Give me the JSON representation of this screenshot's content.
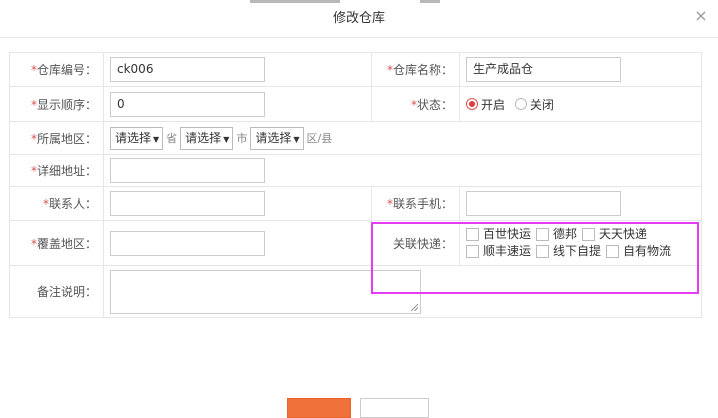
{
  "dialog": {
    "title": "修改仓库",
    "close": "×"
  },
  "form": {
    "code": {
      "label": "仓库编号：",
      "value": "ck006"
    },
    "name": {
      "label": "仓库名称：",
      "value": "生产成品仓"
    },
    "order": {
      "label": "显示顺序：",
      "value": "0"
    },
    "status": {
      "label": "状态：",
      "options": [
        "开启",
        "关闭"
      ],
      "selected": "开启"
    },
    "region": {
      "label": "所属地区：",
      "province_select": "请选择",
      "province_unit": "省",
      "city_select": "请选择",
      "city_unit": "市",
      "district_select": "请选择",
      "district_unit": "区/县"
    },
    "address": {
      "label": "详细地址：",
      "value": ""
    },
    "contact": {
      "label": "联系人：",
      "value": ""
    },
    "phone": {
      "label": "联系手机：",
      "value": ""
    },
    "coverage": {
      "label": "覆盖地区：",
      "value": ""
    },
    "express": {
      "label": "关联快递：",
      "options": [
        "百世快运",
        "德邦",
        "天天快递",
        "顺丰速运",
        "线下自提",
        "自有物流"
      ]
    },
    "remark": {
      "label": "备注说明：",
      "value": ""
    }
  },
  "required_mark": "*",
  "colors": {
    "accent": "#f0713a",
    "required": "#d9534f",
    "highlight": "#e43cf0"
  }
}
